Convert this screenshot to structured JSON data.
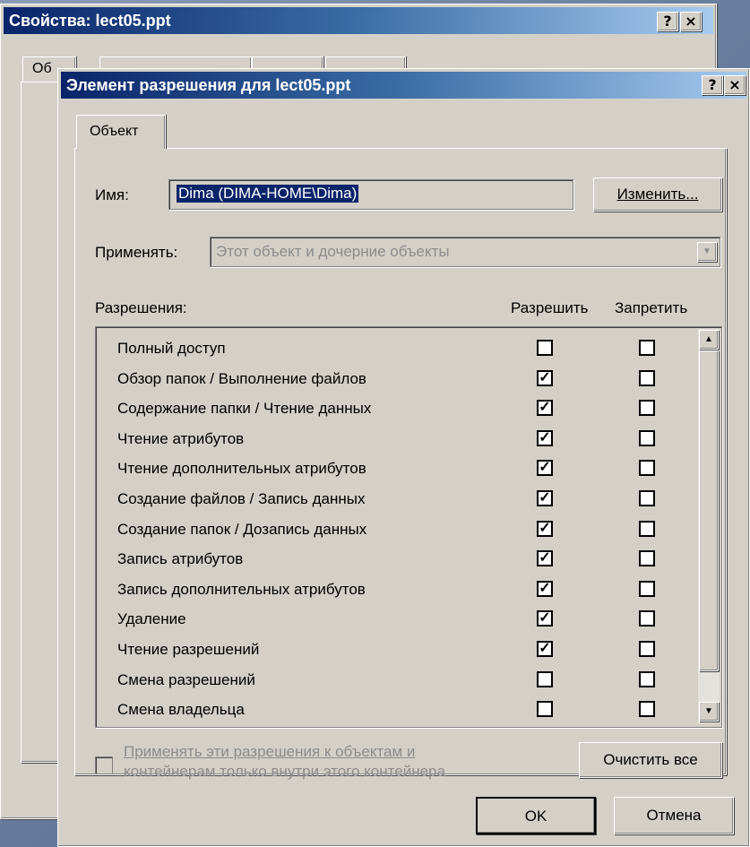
{
  "back_window": {
    "title": "Свойства: lect05.ppt",
    "help_btn": "?",
    "close_btn": "×",
    "tab_first_label": "Об"
  },
  "dialog": {
    "title": "Элемент разрешения для lect05.ppt",
    "help_btn": "?",
    "close_btn": "×",
    "tab_label": "Объект",
    "name_label": "Имя:",
    "name_value": "Dima (DIMA-HOME\\Dima)",
    "change_button": "Изменить...",
    "apply_label": "Применять:",
    "apply_value": "Этот объект и дочерние объекты",
    "permissions_label": "Разрешения:",
    "allow_header": "Разрешить",
    "deny_header": "Запретить",
    "permissions": [
      {
        "name": "Полный доступ",
        "allow": false,
        "deny": false
      },
      {
        "name": "Обзор папок / Выполнение файлов",
        "allow": true,
        "deny": false
      },
      {
        "name": "Содержание папки / Чтение данных",
        "allow": true,
        "deny": false
      },
      {
        "name": "Чтение атрибутов",
        "allow": true,
        "deny": false
      },
      {
        "name": "Чтение дополнительных атрибутов",
        "allow": true,
        "deny": false
      },
      {
        "name": "Создание файлов / Запись данных",
        "allow": true,
        "deny": false
      },
      {
        "name": "Создание папок / Дозапись данных",
        "allow": true,
        "deny": false
      },
      {
        "name": "Запись атрибутов",
        "allow": true,
        "deny": false
      },
      {
        "name": "Запись дополнительных атрибутов",
        "allow": true,
        "deny": false
      },
      {
        "name": "Удаление",
        "allow": true,
        "deny": false
      },
      {
        "name": "Чтение разрешений",
        "allow": true,
        "deny": false
      },
      {
        "name": "Смена разрешений",
        "allow": false,
        "deny": false
      },
      {
        "name": "Смена владельца",
        "allow": false,
        "deny": false
      }
    ],
    "apply_only_line1": "Применять эти разрешения к объектам и",
    "apply_only_line2": "контейнерам только внутри этого контейнера",
    "clear_all_button": "Очистить все",
    "ok_button": "OK",
    "cancel_button": "Отмена"
  },
  "colors": {
    "titlebar_start": "#0a246a",
    "titlebar_end": "#a6caf0",
    "face": "#d4d0c8",
    "selection": "#0a246a"
  }
}
